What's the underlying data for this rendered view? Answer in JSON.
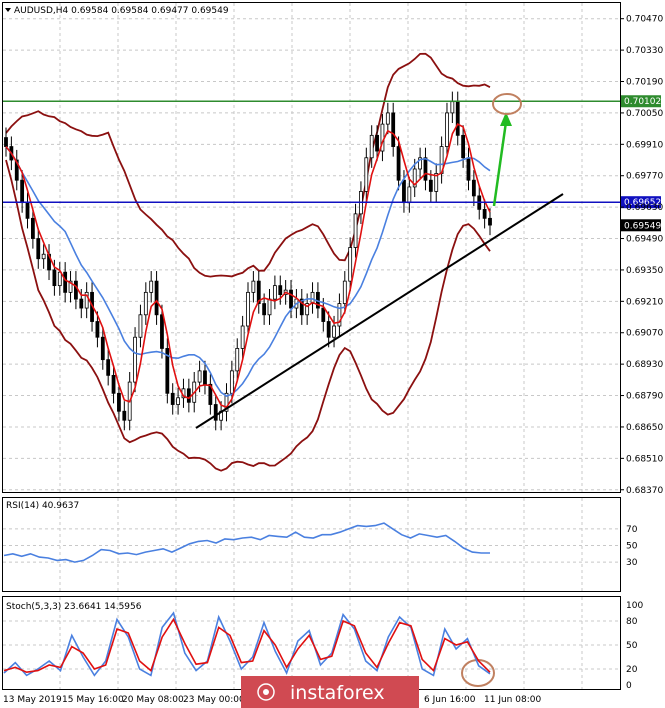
{
  "chart_data": {
    "type": "candlestick",
    "symbol_header": "AUDUSD,H4 0.69584 0.69584 0.69477 0.69549",
    "price_axis": {
      "ticks": [
        "0.70470",
        "0.70330",
        "0.70190",
        "0.70050",
        "0.69910",
        "0.69770",
        "0.69630",
        "0.69490",
        "0.69350",
        "0.69210",
        "0.69070",
        "0.68930",
        "0.68790",
        "0.68650",
        "0.68510",
        "0.68370"
      ],
      "ylim": [
        0.6836,
        0.7054
      ]
    },
    "time_axis": {
      "ticks": [
        "13 May 2019",
        "15 May 16:00",
        "20 May 08:00",
        "23 May 00:00",
        "6 Jun 16:00",
        "11 Jun 08:00"
      ]
    },
    "levels": [
      {
        "label": "0.70102",
        "value": 0.70102,
        "color": "#2e8b2e"
      },
      {
        "label": "0.69652",
        "value": 0.69652,
        "color": "#1010c0"
      },
      {
        "label": "0.69549",
        "value": 0.69549,
        "color": "#000000"
      }
    ],
    "close_series": [
      0.699,
      0.6984,
      0.6975,
      0.6965,
      0.6958,
      0.6949,
      0.694,
      0.6942,
      0.6935,
      0.6928,
      0.6934,
      0.6925,
      0.693,
      0.6922,
      0.6918,
      0.6925,
      0.6912,
      0.6905,
      0.6895,
      0.6888,
      0.688,
      0.6872,
      0.6868,
      0.6885,
      0.6905,
      0.6915,
      0.6925,
      0.693,
      0.6915,
      0.69,
      0.688,
      0.6875,
      0.6878,
      0.6882,
      0.6876,
      0.6885,
      0.689,
      0.6884,
      0.6875,
      0.6868,
      0.6872,
      0.688,
      0.689,
      0.69,
      0.691,
      0.6925,
      0.693,
      0.692,
      0.6915,
      0.6922,
      0.6928,
      0.6924,
      0.6926,
      0.6918,
      0.6922,
      0.6915,
      0.692,
      0.6925,
      0.6918,
      0.6912,
      0.6905,
      0.691,
      0.692,
      0.693,
      0.6945,
      0.696,
      0.697,
      0.6985,
      0.6995,
      0.6988,
      0.7,
      0.7005,
      0.699,
      0.6975,
      0.6965,
      0.6972,
      0.698,
      0.6985,
      0.6975,
      0.697,
      0.6978,
      0.699,
      0.7005,
      0.701,
      0.6995,
      0.6985,
      0.6975,
      0.6968,
      0.6962,
      0.6958,
      0.6955
    ],
    "rsi": {
      "label": "RSI(14) 40.9637",
      "ticks": [
        "70",
        "50",
        "30"
      ],
      "ylim": [
        0,
        100
      ],
      "values": [
        38,
        40,
        37,
        40,
        36,
        35,
        32,
        33,
        30,
        32,
        38,
        45,
        44,
        40,
        41,
        39,
        42,
        44,
        46,
        42,
        47,
        52,
        55,
        56,
        53,
        58,
        57,
        59,
        60,
        57,
        62,
        61,
        60,
        66,
        60,
        59,
        63,
        63,
        66,
        70,
        74,
        73,
        74,
        77,
        70,
        63,
        59,
        64,
        62,
        60,
        62,
        55,
        47,
        42,
        41,
        41
      ]
    },
    "stoch": {
      "label": "Stoch(5,3,3) 23.6641 14.5956",
      "ticks": [
        "100",
        "80",
        "50",
        "20",
        "0"
      ],
      "ylim": [
        0,
        100
      ],
      "main": [
        15,
        28,
        12,
        20,
        30,
        18,
        62,
        35,
        12,
        30,
        82,
        60,
        20,
        12,
        72,
        90,
        40,
        18,
        30,
        85,
        55,
        20,
        35,
        78,
        42,
        15,
        55,
        68,
        25,
        40,
        88,
        70,
        30,
        18,
        60,
        85,
        72,
        20,
        12,
        70,
        45,
        58,
        24,
        14
      ],
      "signal": [
        18,
        22,
        16,
        18,
        25,
        22,
        48,
        40,
        20,
        25,
        70,
        65,
        30,
        18,
        60,
        82,
        52,
        26,
        28,
        72,
        62,
        28,
        30,
        68,
        50,
        22,
        45,
        62,
        32,
        36,
        80,
        74,
        40,
        22,
        52,
        78,
        74,
        32,
        18,
        58,
        50,
        54,
        30,
        16
      ]
    },
    "watermark": "instaforex"
  }
}
